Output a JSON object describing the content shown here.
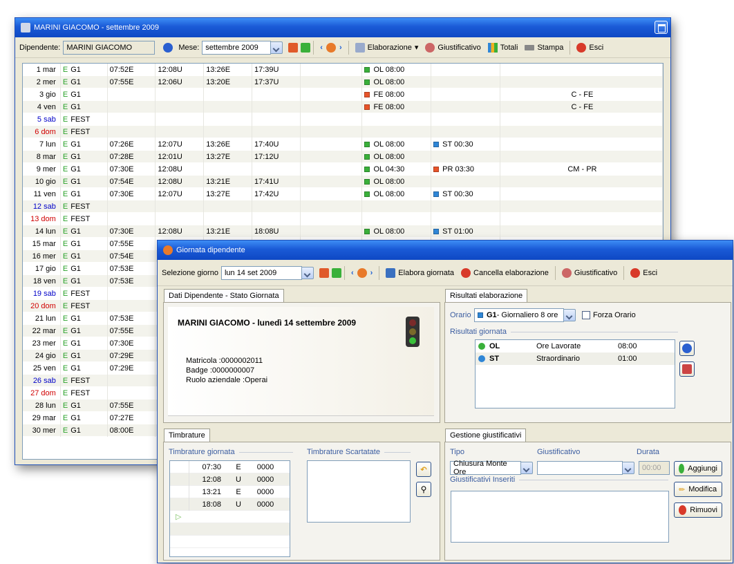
{
  "main": {
    "title": "MARINI GIACOMO - settembre 2009",
    "dip_label": "Dipendente:",
    "dip_value": "MARINI GIACOMO",
    "mese_label": "Mese:",
    "mese_value": "settembre 2009",
    "tb": {
      "elab": "Elaborazione",
      "giust": "Giustificativo",
      "totali": "Totali",
      "stampa": "Stampa",
      "esci": "Esci"
    },
    "rows": [
      {
        "day": "1 mar",
        "d": "",
        "o": "G1",
        "t": [
          "07:52E",
          "12:08U",
          "13:26E",
          "17:39U"
        ],
        "r1": "OL 08:00",
        "r1c": "#3ab03a",
        "r2": "",
        "r2c": "",
        "n": ""
      },
      {
        "day": "2 mer",
        "d": "",
        "o": "G1",
        "t": [
          "07:55E",
          "12:06U",
          "13:20E",
          "17:37U"
        ],
        "r1": "OL 08:00",
        "r1c": "#3ab03a",
        "r2": "",
        "r2c": "",
        "n": ""
      },
      {
        "day": "3 gio",
        "d": "",
        "o": "G1",
        "t": [
          "",
          "",
          "",
          ""
        ],
        "r1": "FE 08:00",
        "r1c": "#e8542a",
        "r2": "",
        "r2c": "",
        "n": "C - FE"
      },
      {
        "day": "4 ven",
        "d": "",
        "o": "G1",
        "t": [
          "",
          "",
          "",
          ""
        ],
        "r1": "FE 08:00",
        "r1c": "#e8542a",
        "r2": "",
        "r2c": "",
        "n": "C - FE"
      },
      {
        "day": "5 sab",
        "d": "blue",
        "o": "FEST",
        "t": [
          "",
          "",
          "",
          ""
        ],
        "r1": "",
        "r1c": "",
        "r2": "",
        "r2c": "",
        "n": ""
      },
      {
        "day": "6 dom",
        "d": "red",
        "o": "FEST",
        "t": [
          "",
          "",
          "",
          ""
        ],
        "r1": "",
        "r1c": "",
        "r2": "",
        "r2c": "",
        "n": ""
      },
      {
        "day": "7 lun",
        "d": "",
        "o": "G1",
        "t": [
          "07:26E",
          "12:07U",
          "13:26E",
          "17:40U"
        ],
        "r1": "OL 08:00",
        "r1c": "#3ab03a",
        "r2": "ST 00:30",
        "r2c": "#2f86d6",
        "n": ""
      },
      {
        "day": "8 mar",
        "d": "",
        "o": "G1",
        "t": [
          "07:28E",
          "12:01U",
          "13:27E",
          "17:12U"
        ],
        "r1": "OL 08:00",
        "r1c": "#3ab03a",
        "r2": "",
        "r2c": "",
        "n": ""
      },
      {
        "day": "9 mer",
        "d": "",
        "o": "G1",
        "t": [
          "07:30E",
          "12:08U",
          "",
          ""
        ],
        "r1": "OL 04:30",
        "r1c": "#3ab03a",
        "r2": "PR 03:30",
        "r2c": "#e8542a",
        "n": "CM - PR"
      },
      {
        "day": "10 gio",
        "d": "",
        "o": "G1",
        "t": [
          "07:54E",
          "12:08U",
          "13:21E",
          "17:41U"
        ],
        "r1": "OL 08:00",
        "r1c": "#3ab03a",
        "r2": "",
        "r2c": "",
        "n": ""
      },
      {
        "day": "11 ven",
        "d": "",
        "o": "G1",
        "t": [
          "07:30E",
          "12:07U",
          "13:27E",
          "17:42U"
        ],
        "r1": "OL 08:00",
        "r1c": "#3ab03a",
        "r2": "ST 00:30",
        "r2c": "#2f86d6",
        "n": ""
      },
      {
        "day": "12 sab",
        "d": "blue",
        "o": "FEST",
        "t": [
          "",
          "",
          "",
          ""
        ],
        "r1": "",
        "r1c": "",
        "r2": "",
        "r2c": "",
        "n": ""
      },
      {
        "day": "13 dom",
        "d": "red",
        "o": "FEST",
        "t": [
          "",
          "",
          "",
          ""
        ],
        "r1": "",
        "r1c": "",
        "r2": "",
        "r2c": "",
        "n": ""
      },
      {
        "day": "14 lun",
        "d": "",
        "o": "G1",
        "t": [
          "07:30E",
          "12:08U",
          "13:21E",
          "18:08U"
        ],
        "r1": "OL 08:00",
        "r1c": "#3ab03a",
        "r2": "ST 01:00",
        "r2c": "#2f86d6",
        "n": ""
      },
      {
        "day": "15 mar",
        "d": "",
        "o": "G1",
        "t": [
          "07:55E",
          "",
          "",
          ""
        ],
        "r1": "",
        "r1c": "",
        "r2": "",
        "r2c": "",
        "n": ""
      },
      {
        "day": "16 mer",
        "d": "",
        "o": "G1",
        "t": [
          "07:54E",
          "",
          "",
          ""
        ],
        "r1": "",
        "r1c": "",
        "r2": "",
        "r2c": "",
        "n": ""
      },
      {
        "day": "17 gio",
        "d": "",
        "o": "G1",
        "t": [
          "07:53E",
          "",
          "",
          ""
        ],
        "r1": "",
        "r1c": "",
        "r2": "",
        "r2c": "",
        "n": ""
      },
      {
        "day": "18 ven",
        "d": "",
        "o": "G1",
        "t": [
          "07:53E",
          "",
          "",
          ""
        ],
        "r1": "",
        "r1c": "",
        "r2": "",
        "r2c": "",
        "n": ""
      },
      {
        "day": "19 sab",
        "d": "blue",
        "o": "FEST",
        "t": [
          "",
          "",
          "",
          ""
        ],
        "r1": "",
        "r1c": "",
        "r2": "",
        "r2c": "",
        "n": ""
      },
      {
        "day": "20 dom",
        "d": "red",
        "o": "FEST",
        "t": [
          "",
          "",
          "",
          ""
        ],
        "r1": "",
        "r1c": "",
        "r2": "",
        "r2c": "",
        "n": ""
      },
      {
        "day": "21 lun",
        "d": "",
        "o": "G1",
        "t": [
          "07:53E",
          "",
          "",
          ""
        ],
        "r1": "",
        "r1c": "",
        "r2": "",
        "r2c": "",
        "n": ""
      },
      {
        "day": "22 mar",
        "d": "",
        "o": "G1",
        "t": [
          "07:55E",
          "",
          "",
          ""
        ],
        "r1": "",
        "r1c": "",
        "r2": "",
        "r2c": "",
        "n": ""
      },
      {
        "day": "23 mer",
        "d": "",
        "o": "G1",
        "t": [
          "07:30E",
          "",
          "",
          ""
        ],
        "r1": "",
        "r1c": "",
        "r2": "",
        "r2c": "",
        "n": ""
      },
      {
        "day": "24 gio",
        "d": "",
        "o": "G1",
        "t": [
          "07:29E",
          "",
          "",
          ""
        ],
        "r1": "",
        "r1c": "",
        "r2": "",
        "r2c": "",
        "n": ""
      },
      {
        "day": "25 ven",
        "d": "",
        "o": "G1",
        "t": [
          "07:29E",
          "",
          "",
          ""
        ],
        "r1": "",
        "r1c": "",
        "r2": "",
        "r2c": "",
        "n": ""
      },
      {
        "day": "26 sab",
        "d": "blue",
        "o": "FEST",
        "t": [
          "",
          "",
          "",
          ""
        ],
        "r1": "",
        "r1c": "",
        "r2": "",
        "r2c": "",
        "n": ""
      },
      {
        "day": "27 dom",
        "d": "red",
        "o": "FEST",
        "t": [
          "",
          "",
          "",
          ""
        ],
        "r1": "",
        "r1c": "",
        "r2": "",
        "r2c": "",
        "n": ""
      },
      {
        "day": "28 lun",
        "d": "",
        "o": "G1",
        "t": [
          "07:55E",
          "",
          "",
          ""
        ],
        "r1": "",
        "r1c": "",
        "r2": "",
        "r2c": "",
        "n": ""
      },
      {
        "day": "29 mar",
        "d": "",
        "o": "G1",
        "t": [
          "07:27E",
          "",
          "",
          ""
        ],
        "r1": "",
        "r1c": "",
        "r2": "",
        "r2c": "",
        "n": ""
      },
      {
        "day": "30 mer",
        "d": "",
        "o": "G1",
        "t": [
          "08:00E",
          "",
          "",
          ""
        ],
        "r1": "",
        "r1c": "",
        "r2": "",
        "r2c": "",
        "n": ""
      }
    ]
  },
  "dlg": {
    "title": "Giornata dipendente",
    "sel_label": "Selezione giorno",
    "sel_value": "lun 14 set 2009",
    "tb": {
      "elab": "Elabora giornata",
      "canc": "Cancella elaborazione",
      "giust": "Giustificativo",
      "esci": "Esci"
    },
    "tab_dati": "Dati Dipendente - Stato Giornata",
    "emp_header": "MARINI GIACOMO - lunedì 14 settembre 2009",
    "matricola": "Matricola :0000002011",
    "badge": "Badge :0000000007",
    "ruolo": "Ruolo aziendale :Operai",
    "tab_ris": "Risultati elaborazione",
    "orario_label": "Orario",
    "orario_code": "G1",
    "orario_desc": " - Giornaliero 8 ore",
    "forza": "Forza Orario",
    "ris_giornata": "Risultati giornata",
    "results": [
      {
        "code": "OL",
        "desc": "Ore Lavorate",
        "val": "08:00",
        "color": "#3ab03a"
      },
      {
        "code": "ST",
        "desc": "Straordinario",
        "val": "01:00",
        "color": "#2f86d6"
      }
    ],
    "tab_timb": "Timbrature",
    "timb_giornata": "Timbrature giornata",
    "timb_scart": "Timbrature Scartatate",
    "timbrature": [
      {
        "t": "07:30",
        "v": "E",
        "c": "0000"
      },
      {
        "t": "12:08",
        "v": "U",
        "c": "0000"
      },
      {
        "t": "13:21",
        "v": "E",
        "c": "0000"
      },
      {
        "t": "18:08",
        "v": "U",
        "c": "0000"
      }
    ],
    "tab_gest": "Gestione giustificativi",
    "tipo_label": "Tipo",
    "giust_label": "Giustificativo",
    "durata_label": "Durata",
    "tipo_value": "Chiusura Monte Ore",
    "durata_value": "00:00",
    "inseriti": "Giustificativi Inseriti",
    "aggiungi": "Aggiungi",
    "modifica": "Modifica",
    "rimuovi": "Rimuovi"
  }
}
